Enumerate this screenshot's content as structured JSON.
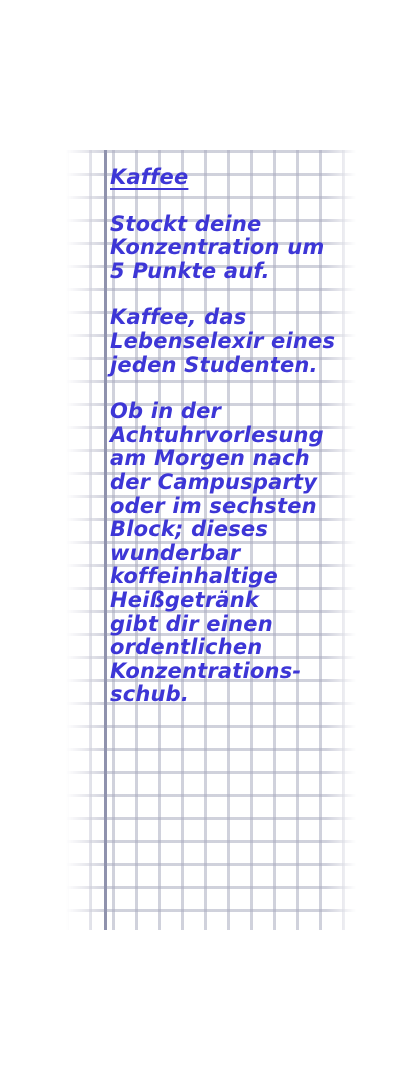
{
  "card": {
    "title": "Kaffee",
    "effect": "Stockt deine\nKonzentration um\n5 Punkte auf.",
    "tagline": "Kaffee, das\nLebenselexir eines\njeden Studenten.",
    "description": "Ob in der\nAchtuhrvorlesung\nam Morgen nach\nder Campusparty\noder im sechsten\nBlock; dieses\nwunderbar\nkoffeinhaltige\nHeißgetränk\ngibt dir einen\nordentlichen\nKonzentrations-\nschub."
  },
  "colors": {
    "ink": "#3d36d6",
    "grid": "#aaacc0",
    "margin_line": "#8f92ad",
    "paper": "#ffffff"
  }
}
